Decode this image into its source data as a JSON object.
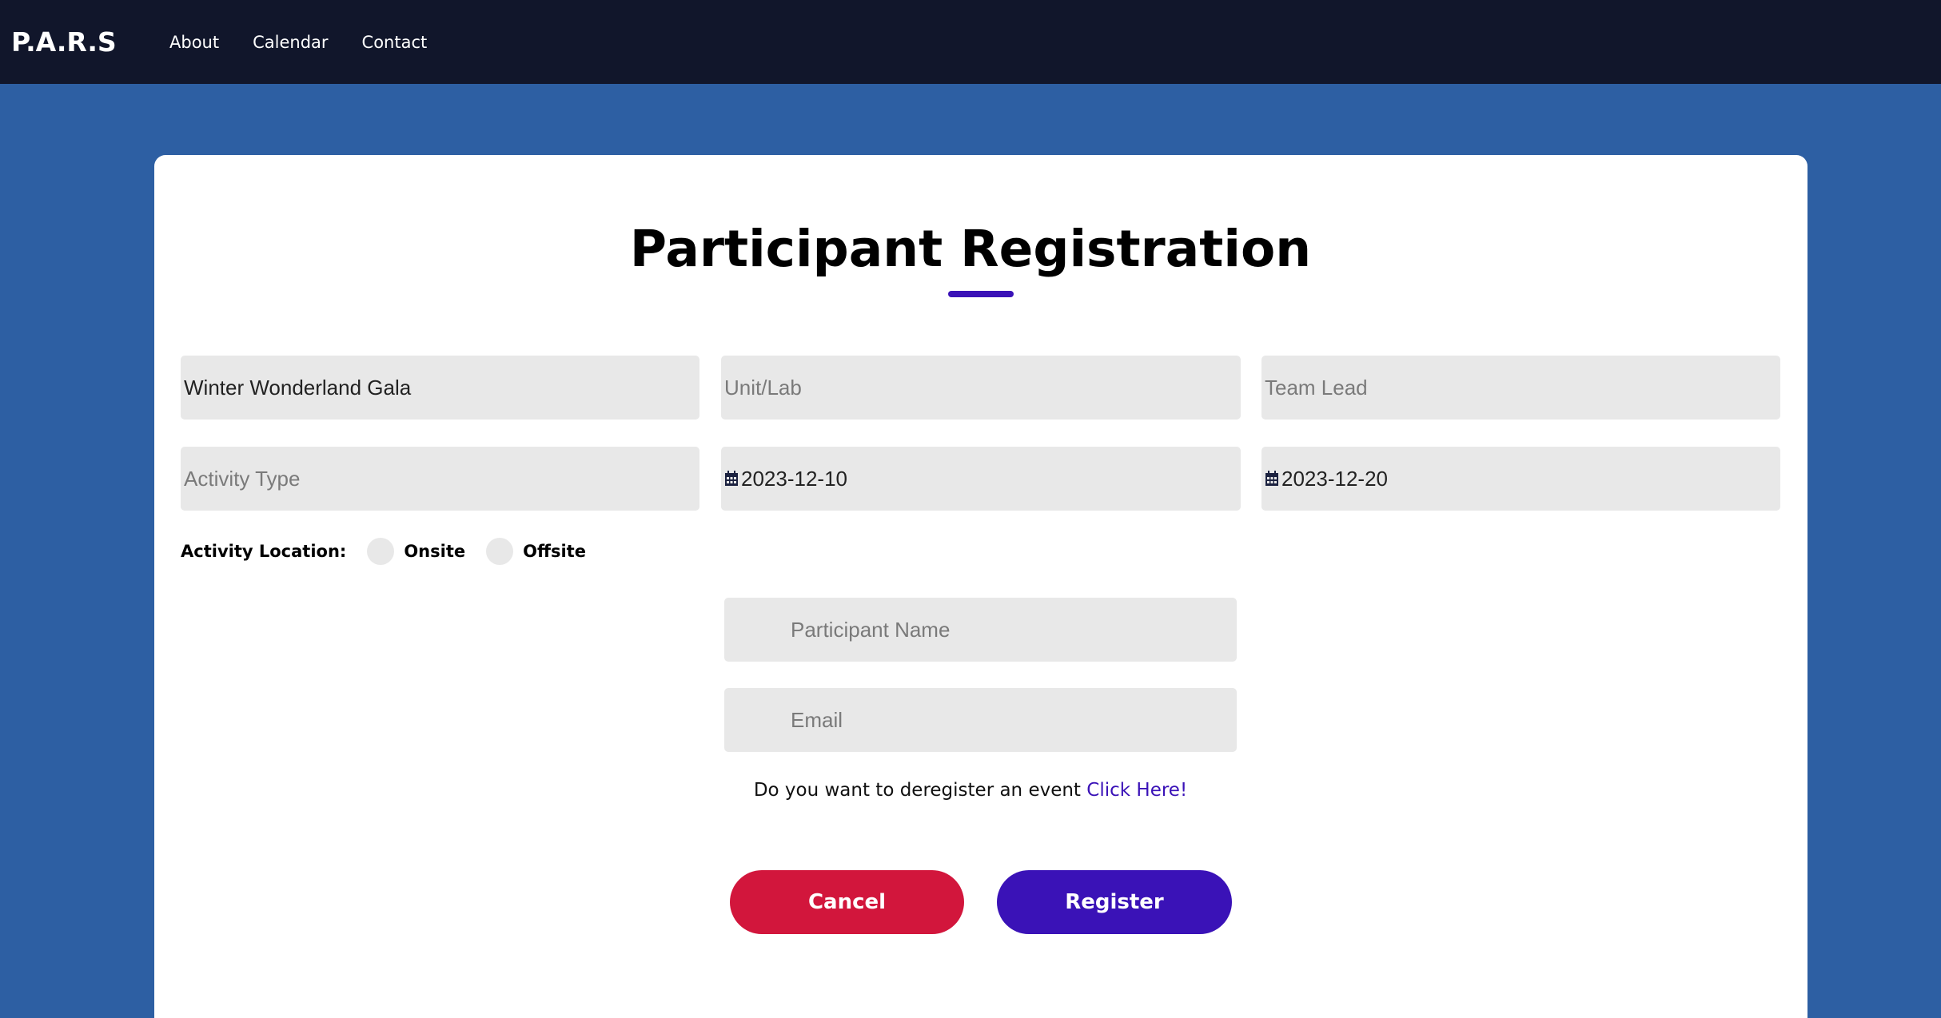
{
  "nav": {
    "brand": "P.A.R.S",
    "links": [
      "About",
      "Calendar",
      "Contact"
    ]
  },
  "page": {
    "title": "Participant Registration"
  },
  "form": {
    "event_name": {
      "value": "Winter Wonderland Gala",
      "placeholder": ""
    },
    "unit_lab": {
      "value": "",
      "placeholder": "Unit/Lab"
    },
    "team_lead": {
      "value": "",
      "placeholder": "Team Lead"
    },
    "activity_type": {
      "value": "",
      "placeholder": "Activity Type"
    },
    "start_date": {
      "value": "2023-12-10",
      "icon": "calendar-icon"
    },
    "end_date": {
      "value": "2023-12-20",
      "icon": "calendar-icon"
    },
    "location": {
      "label": "Activity Location:",
      "options": [
        "Onsite",
        "Offsite"
      ]
    },
    "participant_name": {
      "placeholder": "Participant Name"
    },
    "email": {
      "placeholder": "Email"
    },
    "deregister_text": "Do you want to deregister an event",
    "deregister_link": "Click Here!",
    "cancel_label": "Cancel",
    "register_label": "Register"
  },
  "colors": {
    "navbar": "#11162b",
    "background": "#2d5fa3",
    "accent": "#3a12b7",
    "cancel": "#d2163c",
    "field": "#e8e8e8"
  }
}
